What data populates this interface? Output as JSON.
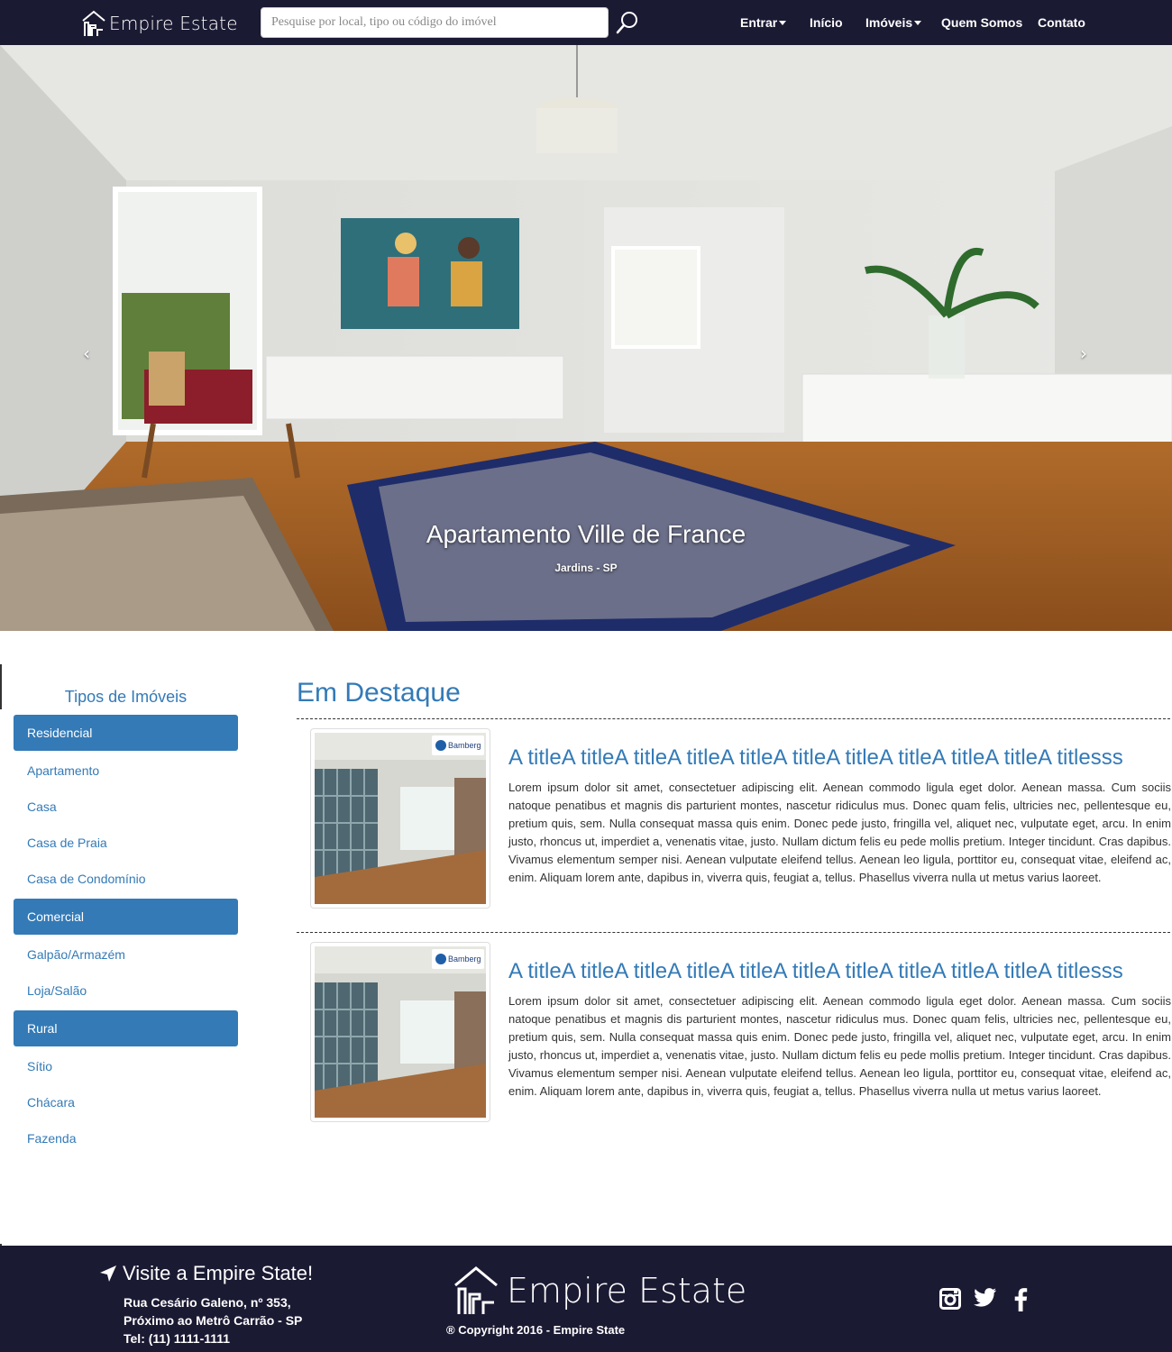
{
  "header": {
    "brand_name": "Empire Estate",
    "search_placeholder": "Pesquise por local, tipo ou código do imóvel",
    "nav": {
      "login": "Entrar",
      "home": "Início",
      "properties": "Imóveis",
      "about": "Quem Somos",
      "contact": "Contato"
    }
  },
  "hero": {
    "title": "Apartamento Ville de France",
    "location": "Jardins - SP",
    "prev_icon": "chevron-left-icon",
    "next_icon": "chevron-right-icon"
  },
  "sidebar": {
    "title": "Tipos de Imóveis",
    "categories": [
      {
        "label": "Residencial",
        "items": [
          "Apartamento",
          "Casa",
          "Casa de Praia",
          "Casa de Condomínio"
        ]
      },
      {
        "label": "Comercial",
        "items": [
          "Galpão/Armazém",
          "Loja/Salão"
        ]
      },
      {
        "label": "Rural",
        "items": [
          "Sítio",
          "Chácara",
          "Fazenda"
        ]
      }
    ]
  },
  "featured": {
    "title": "Em Destaque",
    "listings": [
      {
        "title": "A titleA titleA titleA titleA titleA titleA titleA titleA titleA titleA titlesss",
        "description": "Lorem ipsum dolor sit amet, consectetuer adipiscing elit. Aenean commodo ligula eget dolor. Aenean massa. Cum sociis natoque penatibus et magnis dis parturient montes, nascetur ridiculus mus. Donec quam felis, ultricies nec, pellentesque eu, pretium quis, sem. Nulla consequat massa quis enim. Donec pede justo, fringilla vel, aliquet nec, vulputate eget, arcu. In enim justo, rhoncus ut, imperdiet a, venenatis vitae, justo. Nullam dictum felis eu pede mollis pretium. Integer tincidunt. Cras dapibus. Vivamus elementum semper nisi. Aenean vulputate eleifend tellus. Aenean leo ligula, porttitor eu, consequat vitae, eleifend ac, enim. Aliquam lorem ante, dapibus in, viverra quis, feugiat a, tellus. Phasellus viverra nulla ut metus varius laoreet.",
        "watermark": "Bamberg"
      },
      {
        "title": "A titleA titleA titleA titleA titleA titleA titleA titleA titleA titleA titlesss",
        "description": "Lorem ipsum dolor sit amet, consectetuer adipiscing elit. Aenean commodo ligula eget dolor. Aenean massa. Cum sociis natoque penatibus et magnis dis parturient montes, nascetur ridiculus mus. Donec quam felis, ultricies nec, pellentesque eu, pretium quis, sem. Nulla consequat massa quis enim. Donec pede justo, fringilla vel, aliquet nec, vulputate eget, arcu. In enim justo, rhoncus ut, imperdiet a, venenatis vitae, justo. Nullam dictum felis eu pede mollis pretium. Integer tincidunt. Cras dapibus. Vivamus elementum semper nisi. Aenean vulputate eleifend tellus. Aenean leo ligula, porttitor eu, consequat vitae, eleifend ac, enim. Aliquam lorem ante, dapibus in, viverra quis, feugiat a, tellus. Phasellus viverra nulla ut metus varius laoreet.",
        "watermark": "Bamberg"
      }
    ]
  },
  "footer": {
    "visit_heading": "Visite a Empire State!",
    "address_line1": "Rua Cesário Galeno, nº 353,",
    "address_line2": "Próximo ao Metrô Carrão - SP",
    "phone": "Tel: (11) 1111-1111",
    "brand_name": "Empire Estate",
    "copyright": "® Copyright 2016 - Empire State",
    "social": [
      "instagram-icon",
      "twitter-icon",
      "facebook-icon"
    ]
  },
  "colors": {
    "navbar": "#1b1a33",
    "accent": "#337ab7"
  }
}
